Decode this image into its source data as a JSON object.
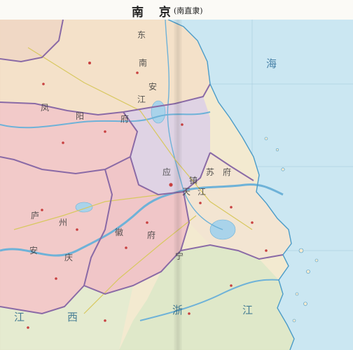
{
  "title": "南 京",
  "subtitle": "(南直隶)",
  "labels": {
    "dong": "东",
    "nan_top": "南",
    "jiang_n": "江",
    "an": "安",
    "feng": "凤",
    "yang": "阳",
    "fu_n": "府",
    "ying": "应",
    "tian": "天",
    "su": "苏",
    "fu_e": "府",
    "zhen": "镇",
    "jiang_m": "江",
    "lu": "庐",
    "zhou": "州",
    "an2": "安",
    "qing": "庆",
    "hui": "徽",
    "fu_s": "府",
    "ning": "宁",
    "jiang_s": "江",
    "xi": "西",
    "zhe": "浙",
    "jiang_se": "江",
    "hai": "海"
  },
  "colors": {
    "sea": "#cbe7f2",
    "land_north": "#f4e0c8",
    "land_pink": "#f2c6c8",
    "land_purple": "#ddd0e6",
    "land_cream": "#f3ead0",
    "land_green": "#dde8c8",
    "border": "#8a6aa6",
    "river": "#6eb2d8",
    "road": "#d8c860"
  }
}
